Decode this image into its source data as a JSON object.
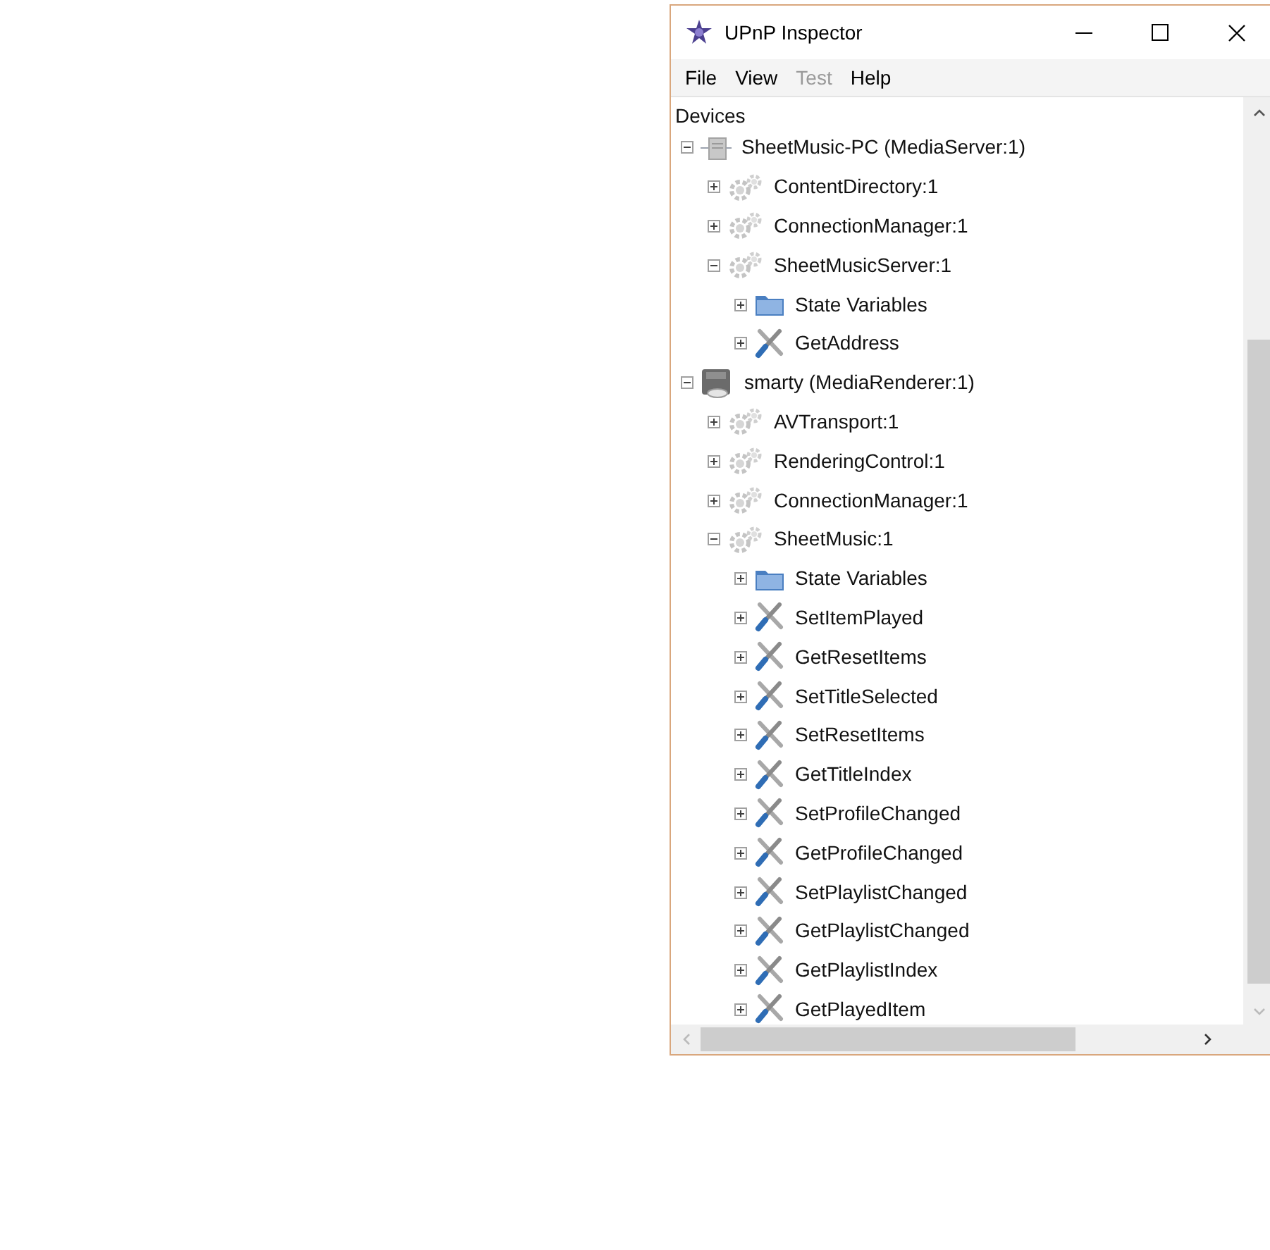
{
  "window": {
    "title": "UPnP Inspector"
  },
  "menu": [
    {
      "label": "File",
      "disabled": false
    },
    {
      "label": "View",
      "disabled": false
    },
    {
      "label": "Test",
      "disabled": true
    },
    {
      "label": "Help",
      "disabled": false
    }
  ],
  "tree": {
    "root_label": "Devices",
    "items": [
      {
        "kind": "server",
        "label": "SheetMusic-PC (MediaServer:1)",
        "expanded": true,
        "children": [
          {
            "kind": "service",
            "label": "ContentDirectory:1",
            "expanded": false
          },
          {
            "kind": "service",
            "label": "ConnectionManager:1",
            "expanded": false
          },
          {
            "kind": "service",
            "label": "SheetMusicServer:1",
            "expanded": true,
            "children": [
              {
                "kind": "folder",
                "label": "State Variables",
                "expanded": false
              },
              {
                "kind": "action",
                "label": "GetAddress",
                "expanded": false
              }
            ]
          }
        ]
      },
      {
        "kind": "renderer",
        "label": "smarty (MediaRenderer:1)",
        "expanded": true,
        "children": [
          {
            "kind": "service",
            "label": "AVTransport:1",
            "expanded": false
          },
          {
            "kind": "service",
            "label": "RenderingControl:1",
            "expanded": false
          },
          {
            "kind": "service",
            "label": "ConnectionManager:1",
            "expanded": false
          },
          {
            "kind": "service",
            "label": "SheetMusic:1",
            "expanded": true,
            "children": [
              {
                "kind": "folder",
                "label": "State Variables",
                "expanded": false
              },
              {
                "kind": "action",
                "label": "SetItemPlayed",
                "expanded": false
              },
              {
                "kind": "action",
                "label": "GetResetItems",
                "expanded": false
              },
              {
                "kind": "action",
                "label": "SetTitleSelected",
                "expanded": false
              },
              {
                "kind": "action",
                "label": "SetResetItems",
                "expanded": false
              },
              {
                "kind": "action",
                "label": "GetTitleIndex",
                "expanded": false
              },
              {
                "kind": "action",
                "label": "SetProfileChanged",
                "expanded": false
              },
              {
                "kind": "action",
                "label": "GetProfileChanged",
                "expanded": false
              },
              {
                "kind": "action",
                "label": "SetPlaylistChanged",
                "expanded": false
              },
              {
                "kind": "action",
                "label": "GetPlaylistChanged",
                "expanded": false
              },
              {
                "kind": "action",
                "label": "GetPlaylistIndex",
                "expanded": false
              },
              {
                "kind": "action",
                "label": "GetPlayedItem",
                "expanded": false
              }
            ]
          }
        ]
      }
    ]
  }
}
